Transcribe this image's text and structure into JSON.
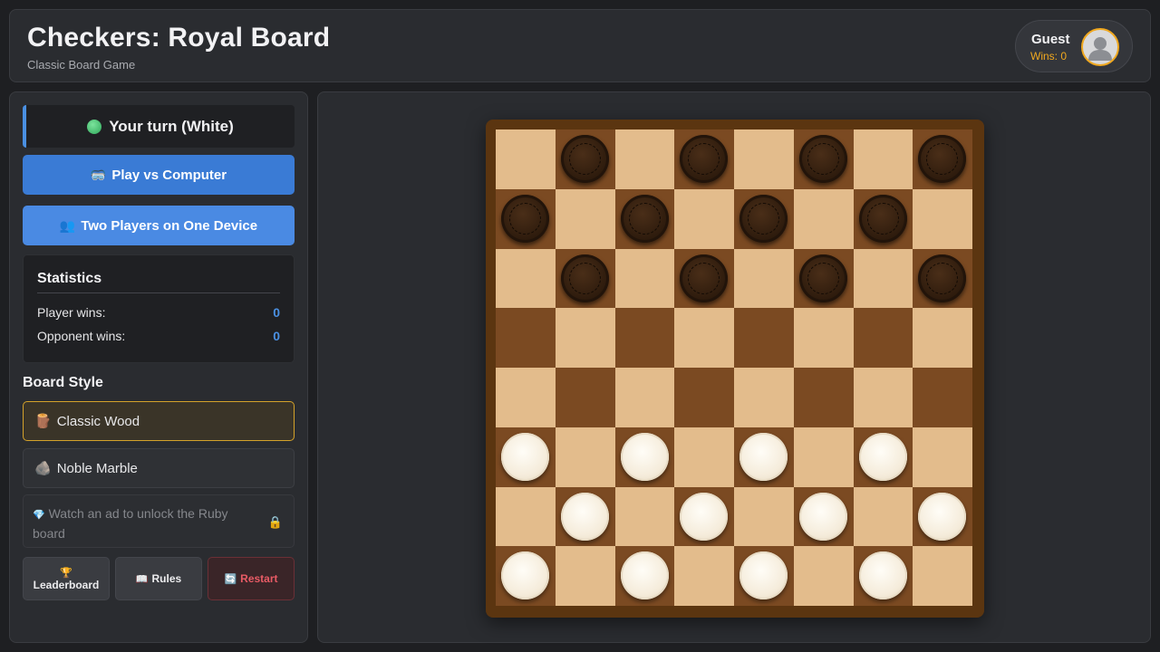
{
  "header": {
    "title": "Checkers: Royal Board",
    "subtitle": "Classic Board Game",
    "user": {
      "name": "Guest",
      "wins": "Wins: 0",
      "avatar_icon": "user-avatar-icon"
    }
  },
  "sidebar": {
    "turn": {
      "text": "Your turn (White)",
      "dot_color": "#3fbf6a"
    },
    "play_vs_computer": {
      "icon": "🥽",
      "label": "Play vs Computer"
    },
    "two_players": {
      "icon": "👥",
      "label": "Two Players on One Device"
    },
    "statistics": {
      "title": "Statistics",
      "rows": [
        {
          "label": "Player wins:",
          "value": "0"
        },
        {
          "label": "Opponent wins:",
          "value": "0"
        }
      ]
    },
    "board_style": {
      "title": "Board Style",
      "options": [
        {
          "icon": "🪵",
          "label": "Classic Wood",
          "selected": true
        },
        {
          "icon": "🪨",
          "label": "Noble Marble",
          "selected": false
        }
      ],
      "locked": {
        "icon": "💎",
        "label": "Watch an ad to unlock the Ruby board",
        "lock_icon": "🔒"
      }
    },
    "actions": {
      "leaderboard": {
        "icon": "🏆",
        "label": "Leaderboard"
      },
      "rules": {
        "icon": "📖",
        "label": "Rules"
      },
      "restart": {
        "icon": "🔄",
        "label": "Restart"
      }
    }
  },
  "board": {
    "style": "Classic Wood",
    "colors": {
      "light": "#e3bc8c",
      "dark": "#7b4a22",
      "frame": "#5b3510"
    },
    "rows": [
      ".b.b.b.b",
      "b.b.b.b.",
      ".b.b.b.b",
      "........",
      "........",
      "w.w.w.w.",
      ".w.w.w.w",
      "w.w.w.w."
    ]
  },
  "colors": {
    "accent": "#4a90e2",
    "gold": "#f0a81f",
    "danger": "#e85b65"
  }
}
